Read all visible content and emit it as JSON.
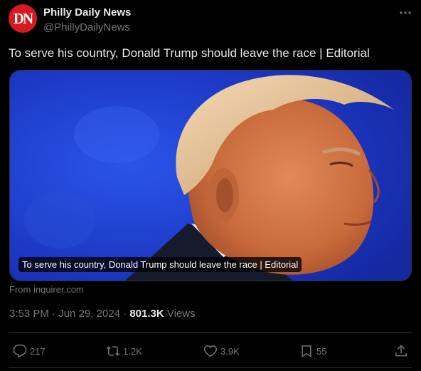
{
  "account": {
    "avatar_text": "DN",
    "display_name": "Philly Daily News",
    "handle": "@PhillyDailyNews"
  },
  "tweet": {
    "text": "To serve his country, Donald Trump should leave the race | Editorial",
    "media_caption": "To serve his country, Donald Trump should leave the race | Editorial",
    "source": "From inquirer.com",
    "time": "3:53 PM",
    "date": "Jun 29, 2024",
    "views_count": "801.3K",
    "views_label": "Views"
  },
  "actions": {
    "replies": "217",
    "reposts": "1.2K",
    "likes": "3.9K",
    "bookmarks": "55"
  },
  "icons": {
    "more": "more-icon",
    "reply": "reply-icon",
    "repost": "repost-icon",
    "like": "heart-icon",
    "bookmark": "bookmark-icon",
    "share": "share-icon"
  },
  "colors": {
    "avatar_bg": "#d71920",
    "text_primary": "#e7e9ea",
    "text_secondary": "#71767b",
    "image_bg": "#1f3fc8"
  }
}
